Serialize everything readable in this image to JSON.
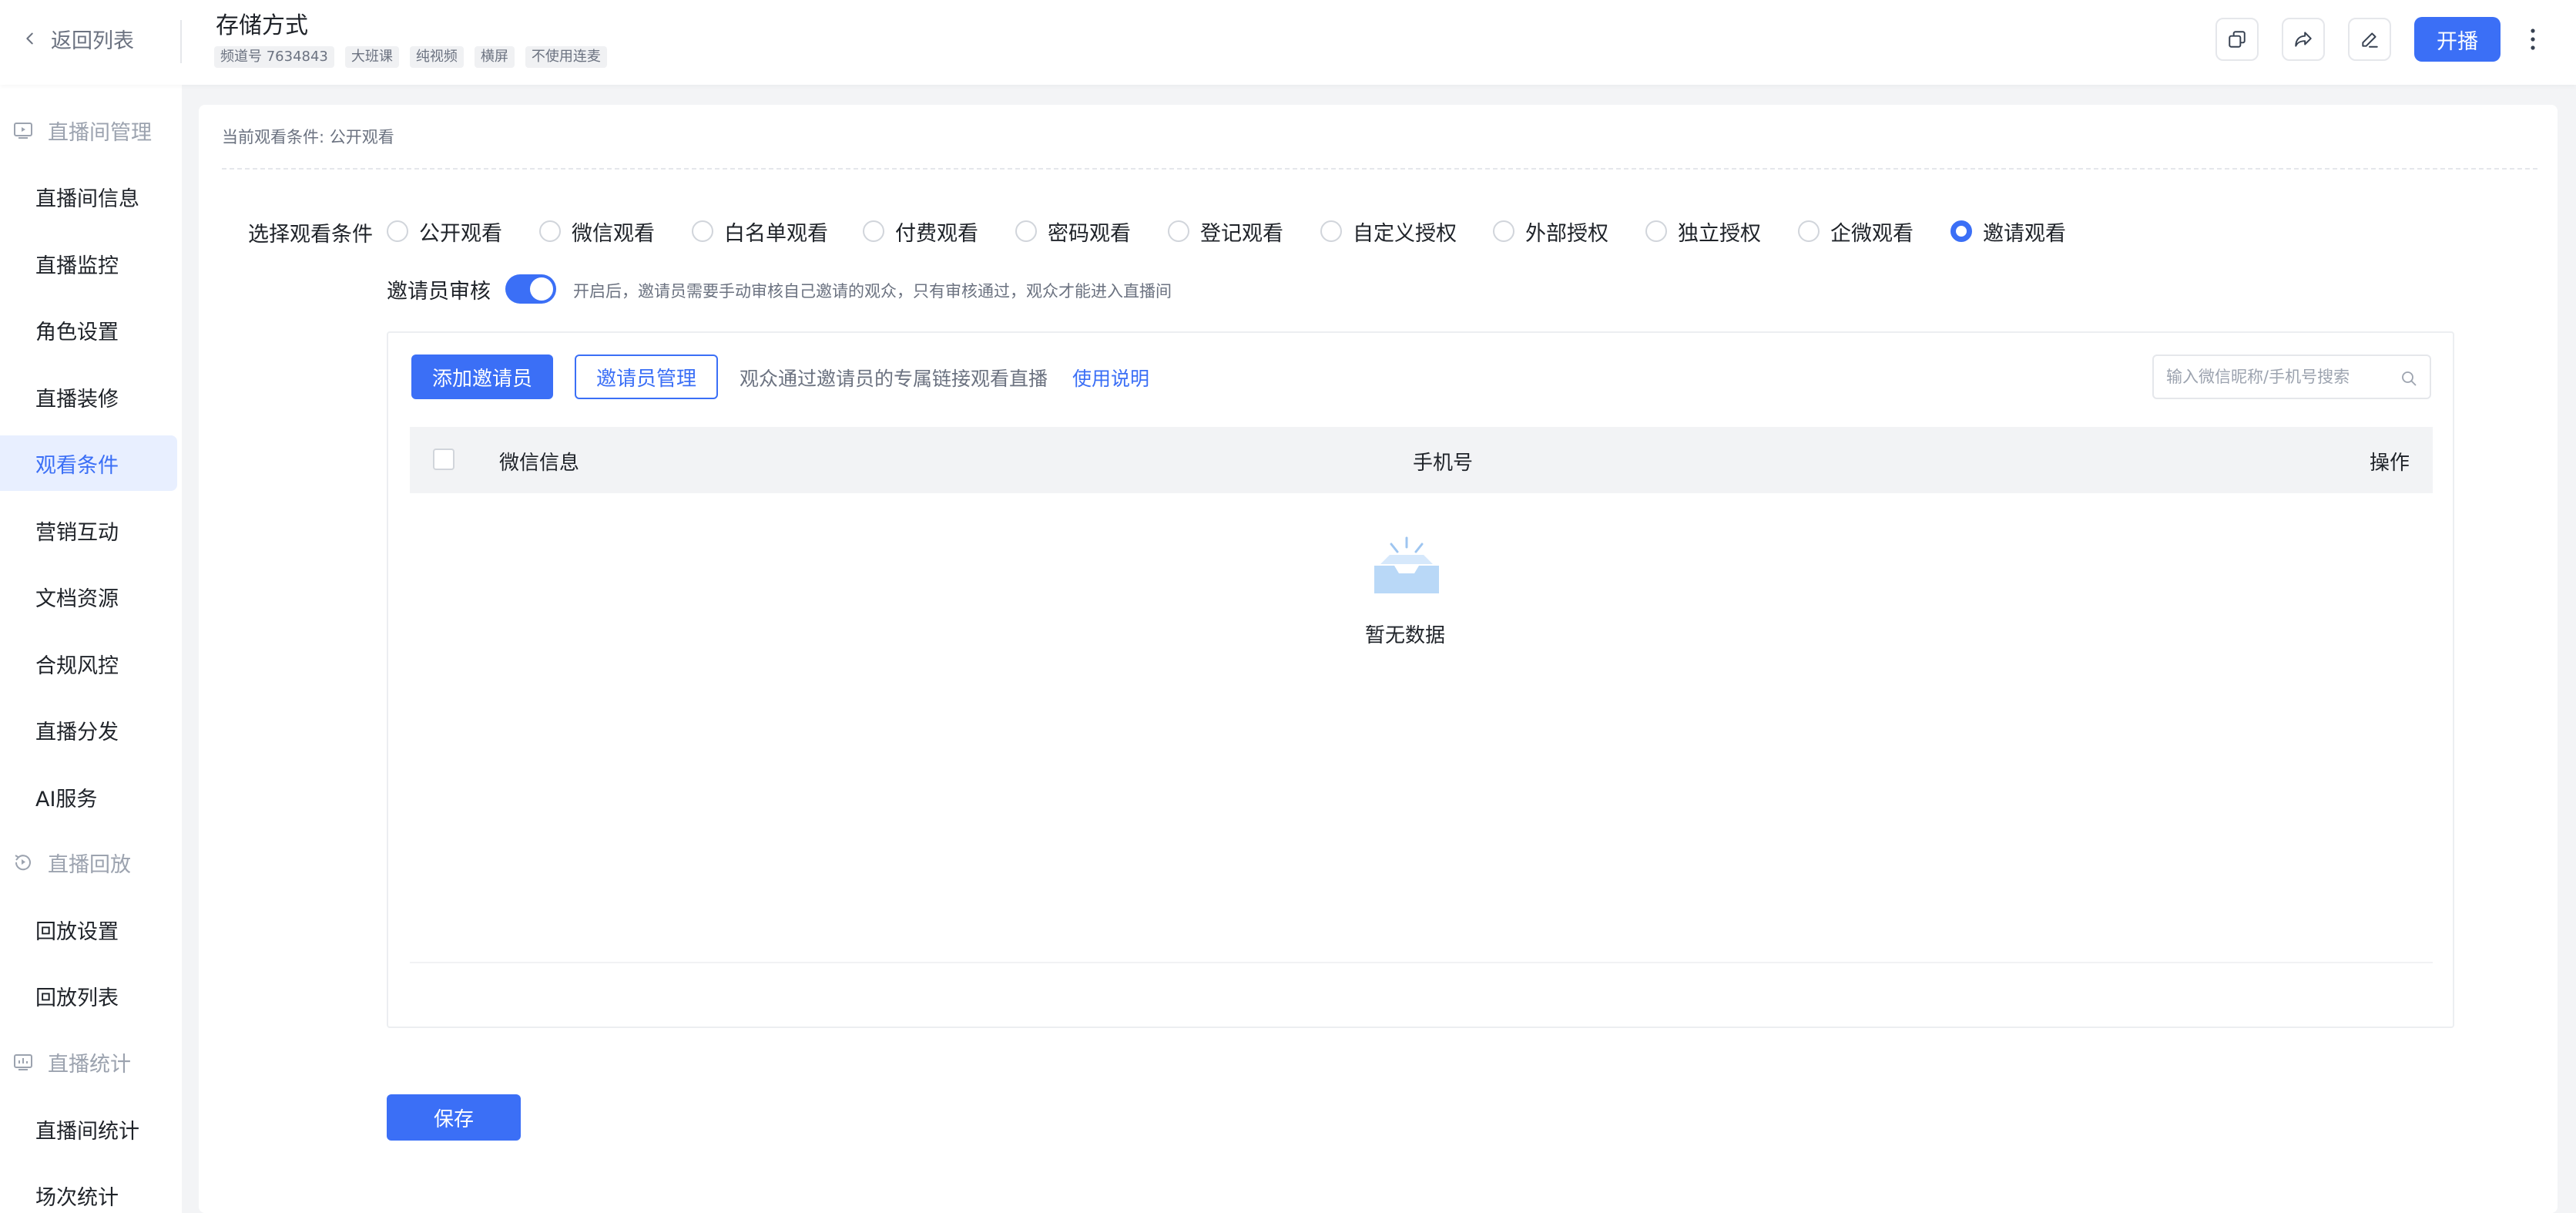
{
  "header": {
    "back_label": "返回列表",
    "title": "存储方式",
    "tags": [
      "频道号 7634843",
      "大班课",
      "纯视频",
      "横屏",
      "不使用连麦"
    ],
    "start_label": "开播",
    "accent_color": "#3b6ff6"
  },
  "sidebar": {
    "groups": [
      {
        "label": "直播间管理",
        "icon": "live-room-icon"
      },
      {
        "label": "直播回放",
        "icon": "playback-icon"
      },
      {
        "label": "直播统计",
        "icon": "statistics-icon"
      }
    ],
    "items": [
      {
        "label": "直播间信息"
      },
      {
        "label": "直播监控"
      },
      {
        "label": "角色设置"
      },
      {
        "label": "直播装修"
      },
      {
        "label": "观看条件",
        "active": true
      },
      {
        "label": "营销互动"
      },
      {
        "label": "文档资源"
      },
      {
        "label": "合规风控"
      },
      {
        "label": "直播分发"
      },
      {
        "label": "AI服务"
      },
      {
        "label": "回放设置"
      },
      {
        "label": "回放列表"
      },
      {
        "label": "直播间统计"
      },
      {
        "label": "场次统计"
      }
    ]
  },
  "main": {
    "current_condition": "当前观看条件: 公开观看",
    "select_label": "选择观看条件",
    "options": [
      {
        "label": "公开观看",
        "checked": false
      },
      {
        "label": "微信观看",
        "checked": false
      },
      {
        "label": "白名单观看",
        "checked": false
      },
      {
        "label": "付费观看",
        "checked": false
      },
      {
        "label": "密码观看",
        "checked": false
      },
      {
        "label": "登记观看",
        "checked": false
      },
      {
        "label": "自定义授权",
        "checked": false
      },
      {
        "label": "外部授权",
        "checked": false
      },
      {
        "label": "独立授权",
        "checked": false
      },
      {
        "label": "企微观看",
        "checked": false
      },
      {
        "label": "邀请观看",
        "checked": true
      }
    ],
    "review": {
      "label": "邀请员审核",
      "enabled": true,
      "hint": "开启后，邀请员需要手动审核自己邀请的观众，只有审核通过，观众才能进入直播间"
    },
    "panel": {
      "add_label": "添加邀请员",
      "manage_label": "邀请员管理",
      "hint": "观众通过邀请员的专属链接观看直播",
      "usage_link": "使用说明",
      "search_placeholder": "输入微信昵称/手机号搜索",
      "search_value": "",
      "columns": [
        "微信信息",
        "手机号",
        "操作"
      ],
      "rows": [],
      "empty_text": "暂无数据"
    },
    "save_label": "保存"
  }
}
